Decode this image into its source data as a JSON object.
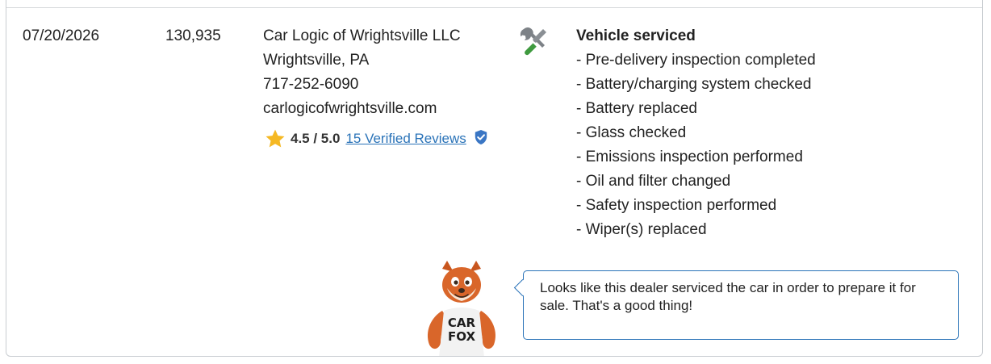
{
  "record": {
    "date": "07/20/2026",
    "odometer": "130,935",
    "source": {
      "name": "Car Logic of Wrightsville LLC",
      "location": "Wrightsville, PA",
      "phone": "717-252-6090",
      "website": "carlogicofwrightsville.com"
    },
    "rating": {
      "score": "4.5 / 5.0",
      "reviews_link": "15 Verified Reviews",
      "star_icon": "star-icon",
      "verified_icon": "verified-shield-icon"
    },
    "service_icon": "wrench-screwdriver-icon",
    "comments": {
      "heading": "Vehicle serviced",
      "items": [
        "- Pre-delivery inspection completed",
        "- Battery/charging system checked",
        "- Battery replaced",
        "- Glass checked",
        "- Emissions inspection performed",
        "- Oil and filter changed",
        "- Safety inspection performed",
        "- Wiper(s) replaced"
      ]
    }
  },
  "carfox": {
    "shirt_line1": "CAR",
    "shirt_line2": "FOX",
    "tip": "Looks like this dealer serviced the car in order to prepare it for sale. That's a good thing!"
  },
  "colors": {
    "link": "#2a73b8",
    "star": "#f5b823",
    "verified": "#3a76c4",
    "wrench": "#7d8287",
    "screwdriver_handle": "#3f9a3f",
    "bubble_border": "#2a73b8"
  }
}
